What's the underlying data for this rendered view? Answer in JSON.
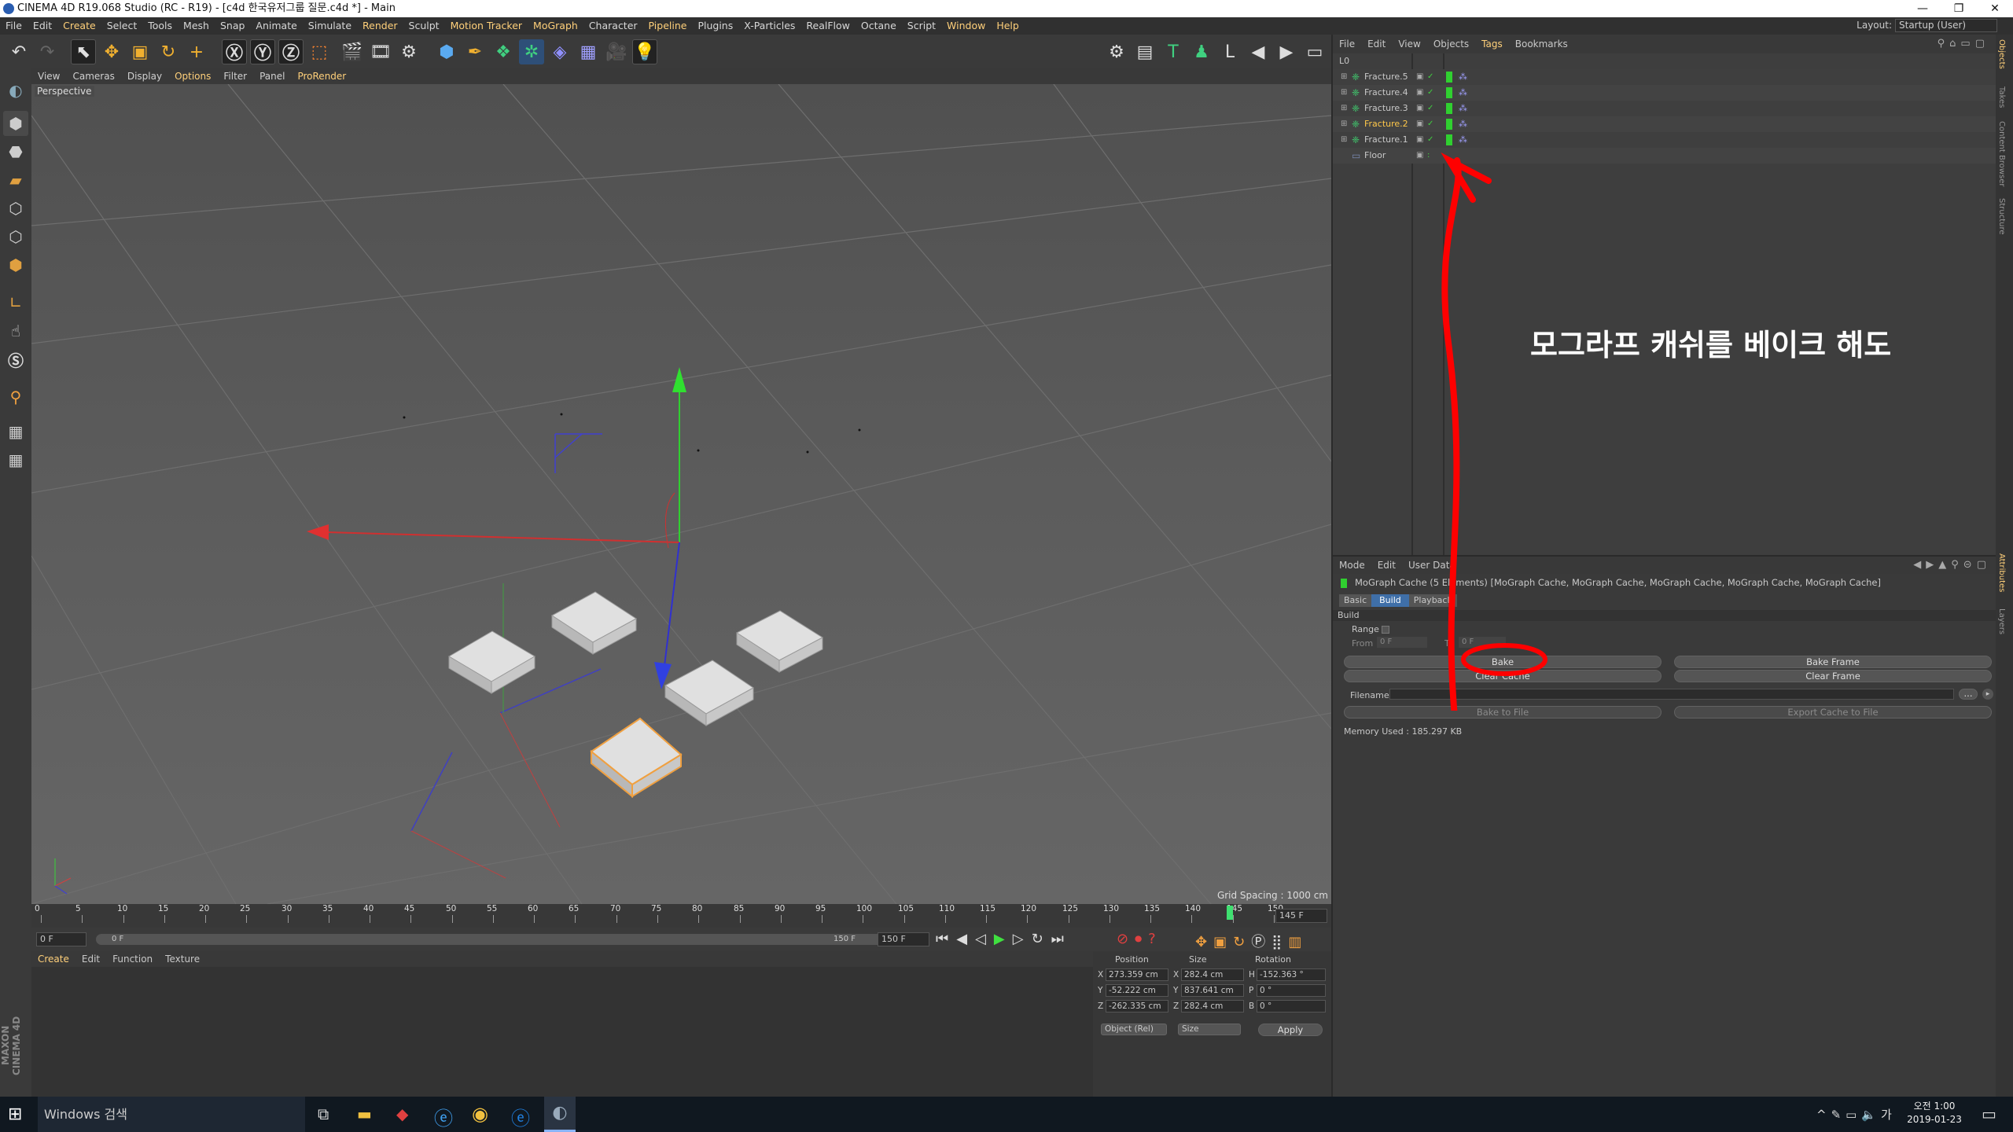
{
  "titlebar": {
    "title": "CINEMA 4D R19.068 Studio (RC - R19) - [c4d 한국유저그룹 질문.c4d *] - Main",
    "min": "—",
    "max": "❐",
    "close": "✕"
  },
  "menu": [
    "File",
    "Edit",
    "Create",
    "Select",
    "Tools",
    "Mesh",
    "Snap",
    "Animate",
    "Simulate",
    "Render",
    "Sculpt",
    "Motion Tracker",
    "MoGraph",
    "Character",
    "Pipeline",
    "Plugins",
    "X-Particles",
    "RealFlow",
    "Octane",
    "Script",
    "Window",
    "Help"
  ],
  "layout": {
    "label": "Layout:",
    "value": "Startup (User)"
  },
  "viewport_menu": [
    "View",
    "Cameras",
    "Display",
    "Options",
    "Filter",
    "Panel",
    "ProRender"
  ],
  "viewport": {
    "label": "Perspective",
    "grid_spacing": "Grid Spacing : 1000 cm"
  },
  "timeline": {
    "ticks": [
      "0",
      "5",
      "10",
      "15",
      "20",
      "25",
      "30",
      "35",
      "40",
      "45",
      "50",
      "55",
      "60",
      "65",
      "70",
      "75",
      "80",
      "85",
      "90",
      "95",
      "100",
      "105",
      "110",
      "115",
      "120",
      "125",
      "130",
      "135",
      "140",
      "145",
      "150"
    ],
    "current_frame": "145 F",
    "start": "0 F",
    "range_start": "0 F",
    "range_end": "150 F",
    "end": "150 F"
  },
  "bottom_menu": [
    "Create",
    "Edit",
    "Function",
    "Texture"
  ],
  "coords": {
    "headers": [
      "Position",
      "Size",
      "Rotation"
    ],
    "rows": [
      {
        "axis": "X",
        "pos": "273.359 cm",
        "saxis": "X",
        "size": "282.4 cm",
        "raxis": "H",
        "rot": "-152.363 °"
      },
      {
        "axis": "Y",
        "pos": "-52.222 cm",
        "saxis": "Y",
        "size": "837.641 cm",
        "raxis": "P",
        "rot": "0 °"
      },
      {
        "axis": "Z",
        "pos": "-262.335 cm",
        "saxis": "Z",
        "size": "282.4 cm",
        "raxis": "B",
        "rot": "0 °"
      }
    ],
    "mode": "Object (Rel)",
    "size_mode": "Size",
    "apply": "Apply"
  },
  "obj_menu": [
    "File",
    "Edit",
    "View",
    "Objects",
    "Tags",
    "Bookmarks"
  ],
  "objects": [
    {
      "name": "Fracture.5",
      "color": "#c8c8c8"
    },
    {
      "name": "Fracture.4",
      "color": "#c8c8c8"
    },
    {
      "name": "Fracture.3",
      "color": "#c8c8c8"
    },
    {
      "name": "Fracture.2",
      "color": "#ffc84a"
    },
    {
      "name": "Fracture.1",
      "color": "#c8c8c8"
    },
    {
      "name": "Floor",
      "color": "#c8c8c8"
    }
  ],
  "layer_label": "L0",
  "attr_menu": [
    "Mode",
    "Edit",
    "User Data"
  ],
  "attr": {
    "title": "MoGraph Cache (5 Elements) [MoGraph Cache, MoGraph Cache, MoGraph Cache, MoGraph Cache, MoGraph Cache]",
    "tabs": [
      "Basic",
      "Build",
      "Playback"
    ],
    "section": "Build",
    "range": "Range",
    "from": "From",
    "from_val": "0 F",
    "to": "To",
    "to_val": "0 F",
    "bake": "Bake",
    "bake_frame": "Bake Frame",
    "clear_cache": "Clear Cache",
    "clear_frame": "Clear Frame",
    "filename": "Filename",
    "browse": "...",
    "bake_to_file": "Bake to File",
    "export": "Export Cache to File",
    "memory": "Memory Used : 185.297 KB"
  },
  "annotation": "모그라프 캐쉬를 베이크 해도",
  "side_tabs": [
    "Objects",
    "Takes",
    "Content Browser",
    "Structure",
    "Attributes",
    "Layers"
  ],
  "maxon": "MAXON CINEMA 4D",
  "taskbar": {
    "search": "Windows 검색",
    "time": "오전 1:00",
    "date": "2019-01-23",
    "ime": "가"
  },
  "colors": {
    "accent": "#ffd07a",
    "annotation": "#ff0000",
    "selected_obj": "#f0a040"
  }
}
